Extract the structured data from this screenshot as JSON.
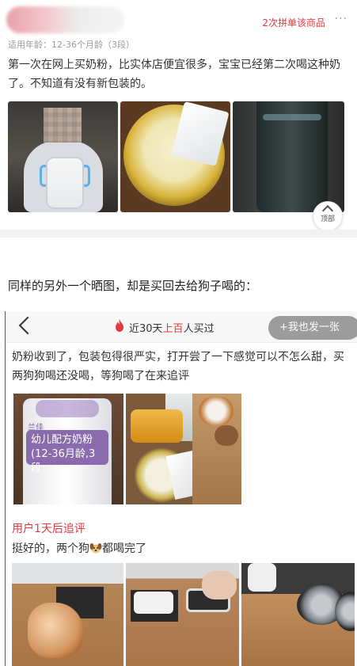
{
  "review_card": {
    "group_purchase_badge": "2次拼单该商品",
    "more": "···",
    "age_info": "适用年龄：12-36个月龄（3段）",
    "review_text": "第一次在网上买奶粉，比实体店便宜很多，宝宝已经第二次喝这种奶了。不知道有没有新包装的。",
    "scroll_top_label": "顶部"
  },
  "caption": "同样的另外一个晒图，却是买回去给狗子喝的：",
  "second_screenshot": {
    "nav": {
      "title_prefix": "近30天",
      "title_highlight": "上百",
      "title_suffix": "人买过",
      "share_button": "+我也发一张"
    },
    "review_text": "奶粉收到了，包装包得很严实，打开尝了一下感觉可以不怎么甜，买两狗狗喝还没喝，等狗喝了在来追评",
    "product_photo": {
      "brand": "兰佳",
      "label": "幼儿配方奶粉(12-36月龄,3段"
    },
    "followup": {
      "label": "用户1天后追评",
      "text_before": "挺好的，两个狗",
      "text_after": "都喝完了"
    }
  },
  "colors": {
    "accent_red": "#e4393c",
    "text": "#333333",
    "muted": "#9a9a9a"
  }
}
